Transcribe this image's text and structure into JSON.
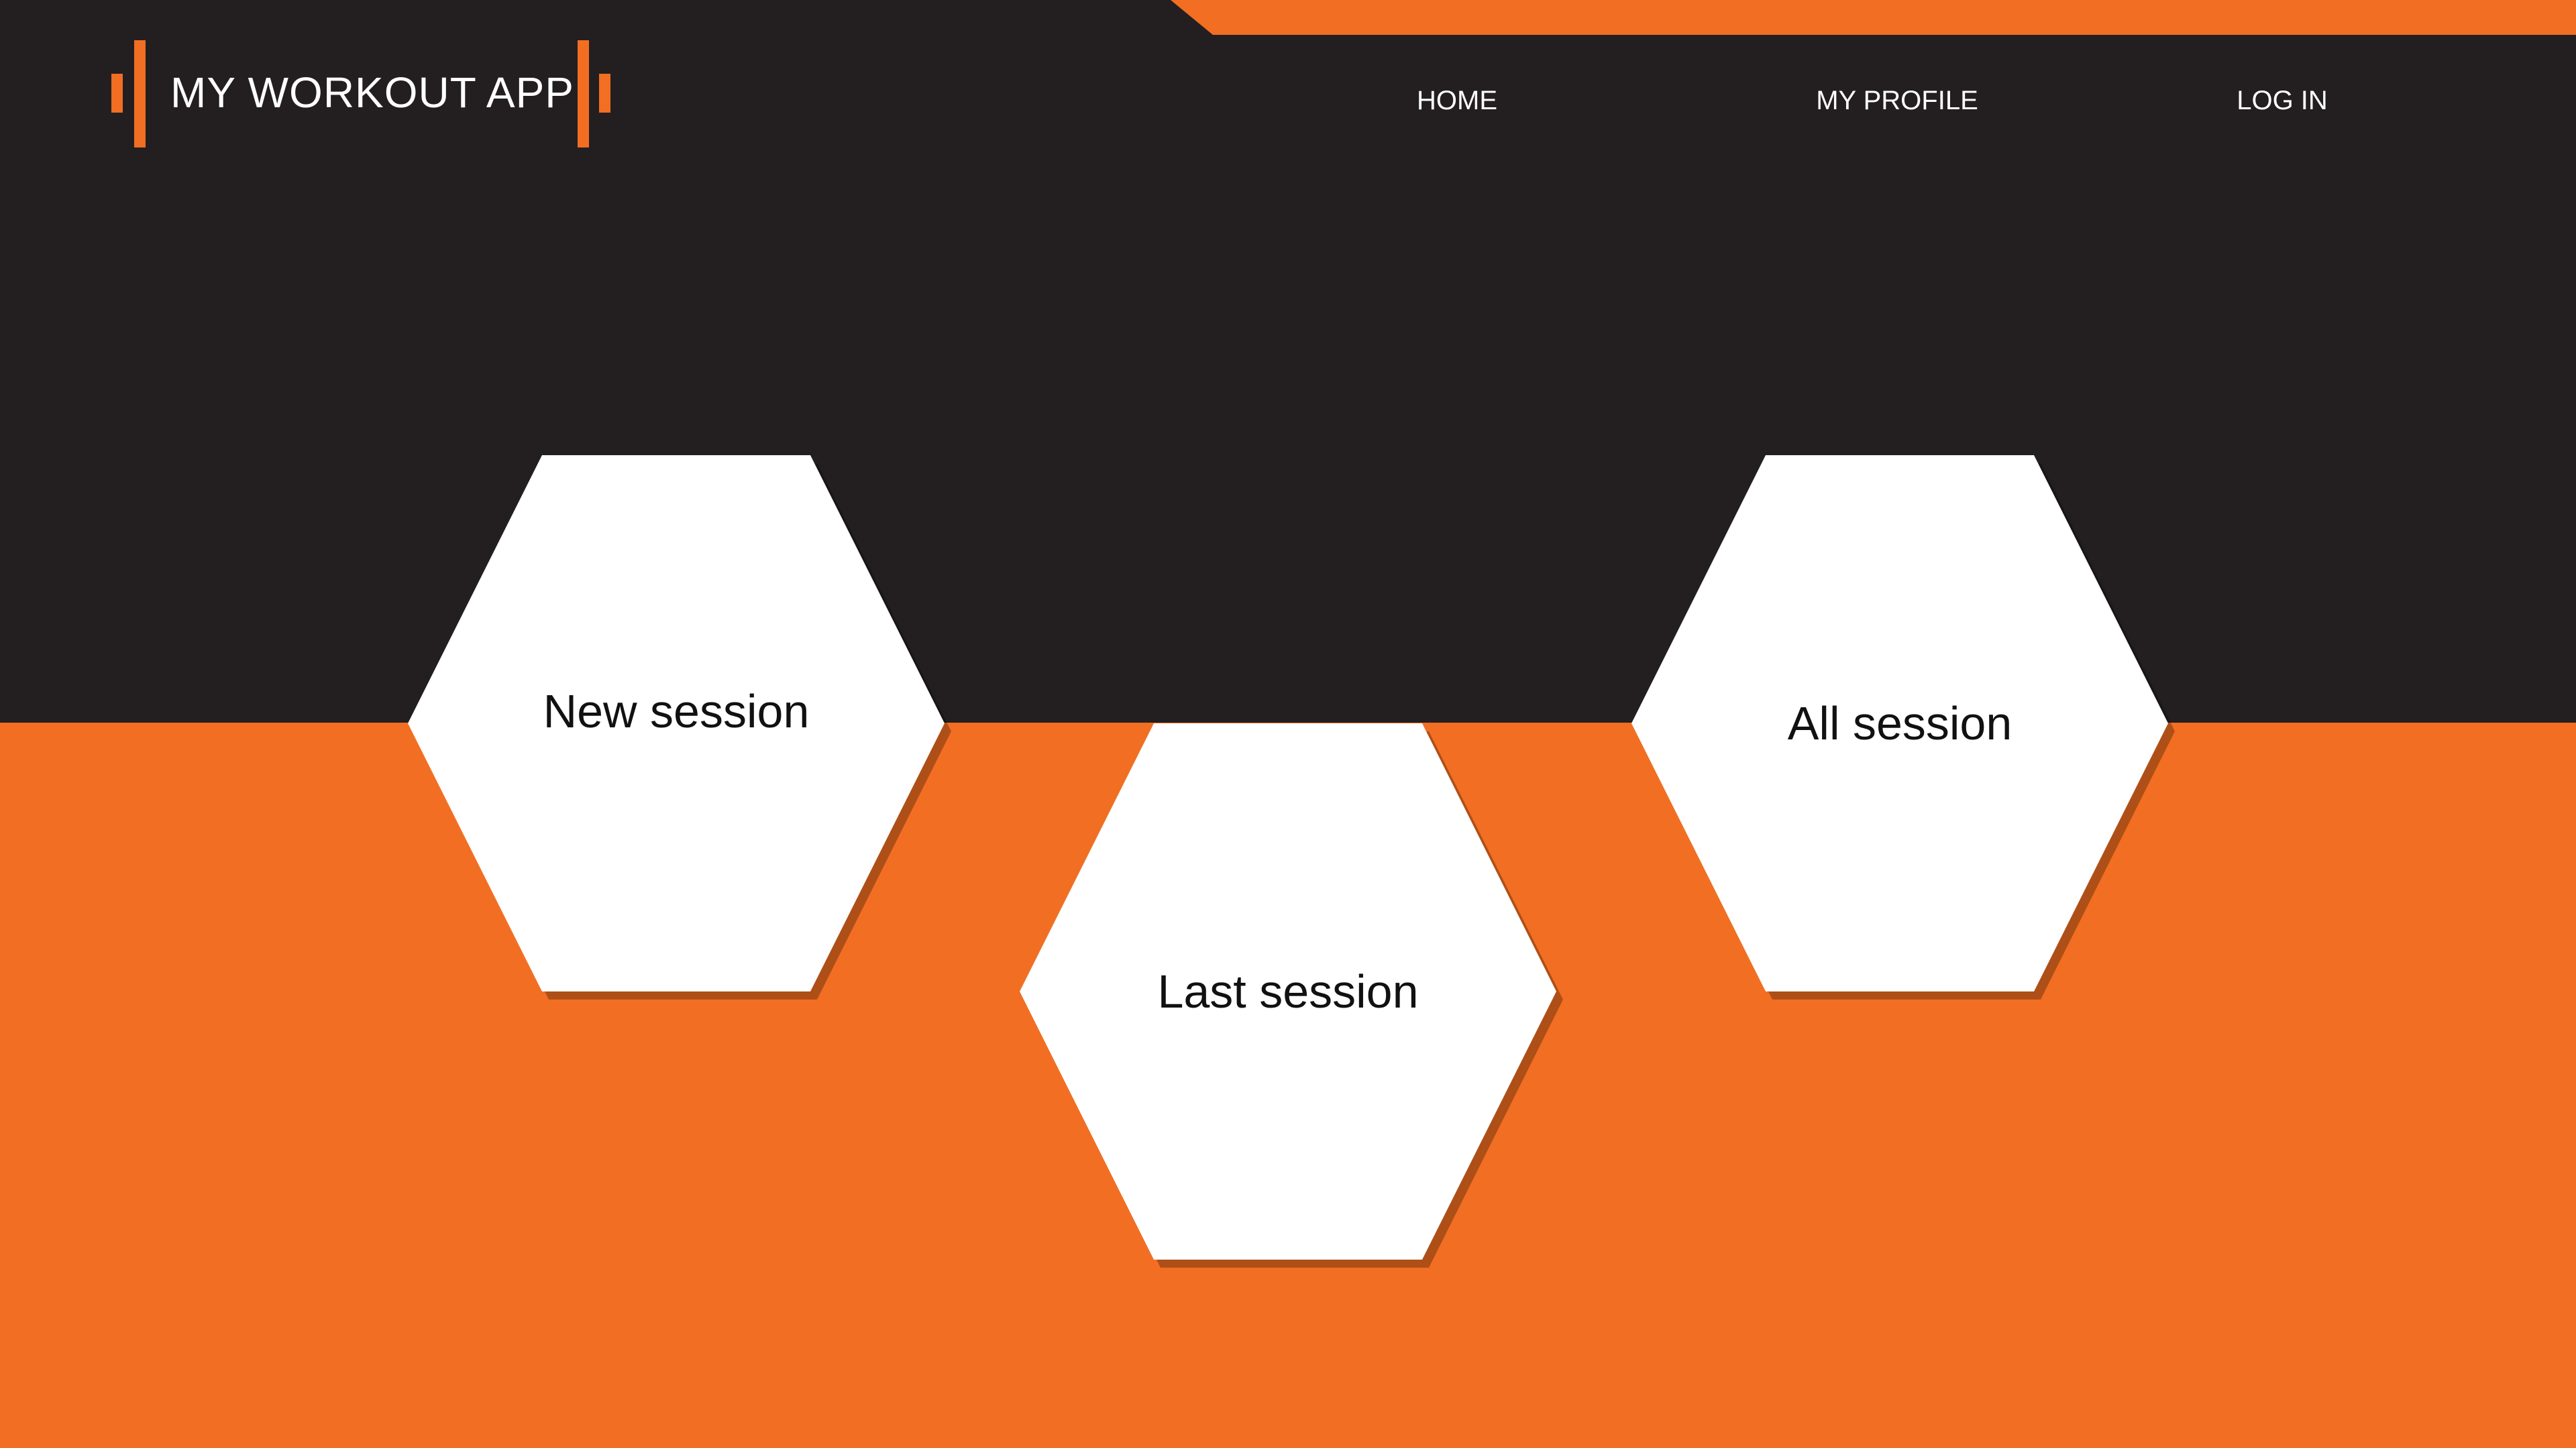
{
  "header": {
    "app_title": "MY WORKOUT APP",
    "nav": [
      {
        "label": "HOME"
      },
      {
        "label": "MY PROFILE"
      },
      {
        "label": "LOG IN"
      }
    ]
  },
  "tiles": [
    {
      "label": "New session"
    },
    {
      "label": "Last session"
    },
    {
      "label": "All session"
    }
  ],
  "colors": {
    "accent": "#f26e22",
    "dark": "#231f20",
    "tile": "#ffffff",
    "text_light": "#ffffff",
    "text_dark": "#111111"
  }
}
